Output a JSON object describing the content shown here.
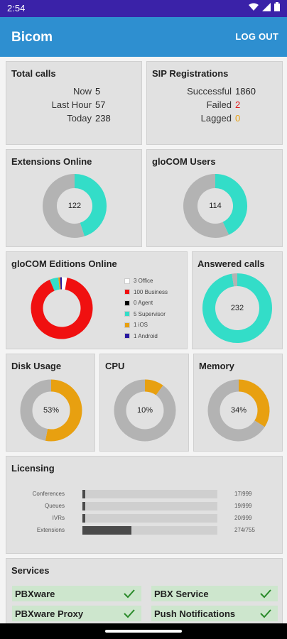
{
  "status_bar": {
    "time": "2:54"
  },
  "app_bar": {
    "title": "Bicom",
    "logout_label": "LOG OUT"
  },
  "total_calls": {
    "title": "Total calls",
    "rows": [
      {
        "label": "Now",
        "value": "5"
      },
      {
        "label": "Last Hour",
        "value": "57"
      },
      {
        "label": "Today",
        "value": "238"
      }
    ]
  },
  "sip_registrations": {
    "title": "SIP Registrations",
    "rows": [
      {
        "label": "Successful",
        "value": "1860",
        "color": "#222222"
      },
      {
        "label": "Failed",
        "value": "2",
        "color": "#e02020"
      },
      {
        "label": "Lagged",
        "value": "0",
        "color": "#e8a010"
      }
    ]
  },
  "extensions_online": {
    "title": "Extensions Online",
    "value": "122",
    "fraction": 0.45
  },
  "glocom_users": {
    "title": "gloCOM Users",
    "value": "114",
    "fraction": 0.43
  },
  "glocom_editions": {
    "title": "gloCOM Editions Online",
    "legend": [
      {
        "label": "3 Office",
        "color": "#ffffff",
        "count": 3
      },
      {
        "label": "100 Business",
        "color": "#f01010",
        "count": 100
      },
      {
        "label": "0 Agent",
        "color": "#000000",
        "count": 0
      },
      {
        "label": "5 Supervisor",
        "color": "#33ddc8",
        "count": 5
      },
      {
        "label": "1 iOS",
        "color": "#e8a010",
        "count": 1
      },
      {
        "label": "1 Android",
        "color": "#2a1aa0",
        "count": 1
      }
    ]
  },
  "answered_calls": {
    "title": "Answered calls",
    "value": "232",
    "fraction": 0.975
  },
  "disk_usage": {
    "title": "Disk Usage",
    "value": "53%",
    "fraction": 0.53
  },
  "cpu": {
    "title": "CPU",
    "value": "10%",
    "fraction": 0.1
  },
  "memory": {
    "title": "Memory",
    "value": "34%",
    "fraction": 0.34
  },
  "licensing": {
    "title": "Licensing",
    "rows": [
      {
        "label": "Conferences",
        "count": "17/999",
        "fraction": 0.017
      },
      {
        "label": "Queues",
        "count": "19/999",
        "fraction": 0.019
      },
      {
        "label": "IVRs",
        "count": "20/999",
        "fraction": 0.02
      },
      {
        "label": "Extensions",
        "count": "274/755",
        "fraction": 0.363
      }
    ]
  },
  "services": {
    "title": "Services",
    "items": [
      {
        "name": "PBXware"
      },
      {
        "name": "PBX Service"
      },
      {
        "name": "PBXware Proxy"
      },
      {
        "name": "Push Notifications"
      }
    ]
  },
  "colors": {
    "teal": "#33ddc8",
    "gray_ring": "#b3b3b3",
    "orange": "#e8a010",
    "red": "#f01010",
    "app_bar": "#2e8fd0",
    "status_bar": "#3a22a8"
  }
}
